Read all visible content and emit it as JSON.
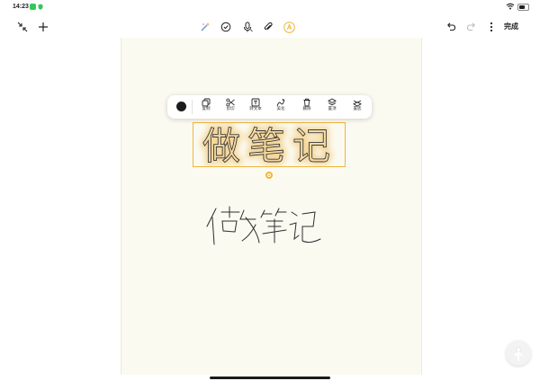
{
  "status_bar": {
    "time": "14:23"
  },
  "toolbar": {
    "left_icons": [
      "collapse-icon",
      "add-icon"
    ],
    "center_icons": [
      "magic-pen-icon",
      "checklist-icon",
      "microphone-icon",
      "attachment-icon",
      "pen-mode-icon"
    ],
    "right_icons": [
      "undo-icon",
      "redo-icon",
      "more-icon"
    ],
    "done_label": "完成",
    "accent": "#f1b53b"
  },
  "context_menu": {
    "color_swatch": "#1c1c1c",
    "items": [
      {
        "icon": "copy-icon",
        "label": "复制"
      },
      {
        "icon": "scissors-icon",
        "label": "剪切"
      },
      {
        "icon": "text-convert-icon",
        "label": "转文本"
      },
      {
        "icon": "beautify-icon",
        "label": "美化"
      },
      {
        "icon": "delete-icon",
        "label": "删除"
      },
      {
        "icon": "bring-front-icon",
        "label": "置顶"
      },
      {
        "icon": "send-back-icon",
        "label": "置底"
      }
    ]
  },
  "canvas": {
    "selected_text": "做笔记",
    "handwriting_text": "做笔记"
  }
}
